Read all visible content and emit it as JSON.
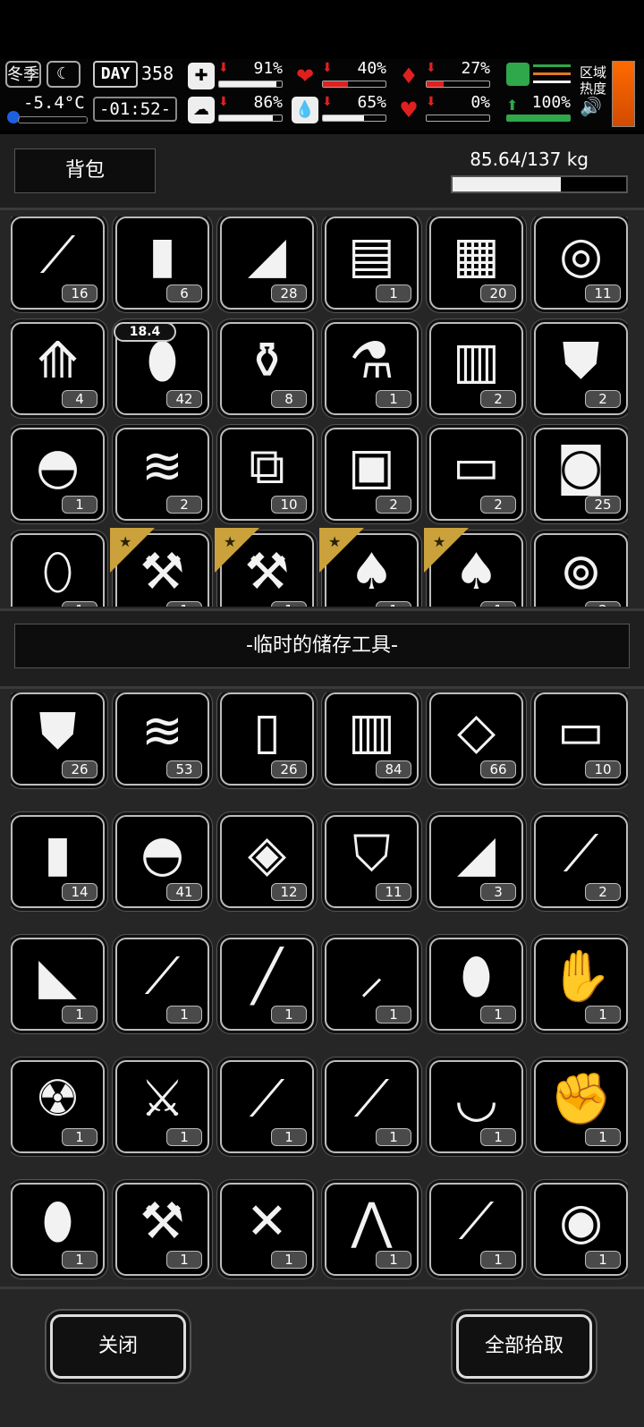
{
  "hud": {
    "season": "冬季",
    "moon": "☾",
    "temperature": "-5.4°C",
    "day_label": "DAY",
    "day": "358",
    "clock": "-01:52-",
    "stats": [
      {
        "name": "health",
        "icon": "✚",
        "pct": "91%",
        "value": 0.91,
        "color": "#f0f0f0",
        "red": false
      },
      {
        "name": "stomach",
        "icon": "❤",
        "pct": "40%",
        "value": 0.4,
        "color": "#e02020",
        "red": true
      },
      {
        "name": "lungs",
        "icon": "♦",
        "pct": "27%",
        "value": 0.27,
        "color": "#e02020",
        "red": true
      },
      {
        "name": "brain",
        "icon": "☁",
        "pct": "86%",
        "value": 0.86,
        "color": "#f0f0f0",
        "red": false
      },
      {
        "name": "water",
        "icon": "💧",
        "pct": "65%",
        "value": 0.65,
        "color": "#f0f0f0",
        "red": false
      },
      {
        "name": "heart",
        "icon": "♥",
        "pct": "0%",
        "value": 0.0,
        "color": "#e02020",
        "red": true
      }
    ],
    "stamina_pct": "100%",
    "region_label": "区域热度",
    "speaker": "🔊"
  },
  "backpack": {
    "tab": "背包",
    "weight": "85.64/137 kg",
    "weight_fill": 0.625,
    "items": [
      {
        "icon": "⟋",
        "count": "16"
      },
      {
        "icon": "▮",
        "count": "6"
      },
      {
        "icon": "◢",
        "count": "28"
      },
      {
        "icon": "▤",
        "count": "1"
      },
      {
        "icon": "▦",
        "count": "20"
      },
      {
        "icon": "◎",
        "count": "11"
      },
      {
        "icon": "⟰",
        "count": "4"
      },
      {
        "icon": "⬮",
        "count": "42",
        "durability": "18.4"
      },
      {
        "icon": "⚱",
        "count": "8"
      },
      {
        "icon": "⚗",
        "count": "1"
      },
      {
        "icon": "▥",
        "count": "2"
      },
      {
        "icon": "⛊",
        "count": "2"
      },
      {
        "icon": "◓",
        "count": "1"
      },
      {
        "icon": "≋",
        "count": "2"
      },
      {
        "icon": "⧉",
        "count": "10"
      },
      {
        "icon": "▣",
        "count": "2"
      },
      {
        "icon": "▭",
        "count": "2"
      },
      {
        "icon": "◙",
        "count": "25"
      },
      {
        "icon": "⬯",
        "count": "1"
      },
      {
        "icon": "⚒",
        "count": "1",
        "star": true
      },
      {
        "icon": "⚒",
        "count": "1",
        "star": true
      },
      {
        "icon": "♠",
        "count": "1",
        "star": true
      },
      {
        "icon": "♠",
        "count": "1",
        "star": true
      },
      {
        "icon": "⊚",
        "count": "2"
      }
    ]
  },
  "storage": {
    "title": "-临时的储存工具-",
    "items": [
      {
        "icon": "⛊",
        "count": "26"
      },
      {
        "icon": "≋",
        "count": "53"
      },
      {
        "icon": "▯",
        "count": "26"
      },
      {
        "icon": "▥",
        "count": "84"
      },
      {
        "icon": "◇",
        "count": "66"
      },
      {
        "icon": "▭",
        "count": "10"
      },
      {
        "icon": "▮",
        "count": "14"
      },
      {
        "icon": "◓",
        "count": "41"
      },
      {
        "icon": "◈",
        "count": "12"
      },
      {
        "icon": "⛉",
        "count": "11"
      },
      {
        "icon": "◢",
        "count": "3"
      },
      {
        "icon": "⟋",
        "count": "2"
      },
      {
        "icon": "◣",
        "count": "1"
      },
      {
        "icon": "⟋",
        "count": "1"
      },
      {
        "icon": "╱",
        "count": "1"
      },
      {
        "icon": "⸝",
        "count": "1"
      },
      {
        "icon": "⬮",
        "count": "1"
      },
      {
        "icon": "✋",
        "count": "1"
      },
      {
        "icon": "☢",
        "count": "1"
      },
      {
        "icon": "⚔",
        "count": "1"
      },
      {
        "icon": "⟋",
        "count": "1"
      },
      {
        "icon": "⟋",
        "count": "1"
      },
      {
        "icon": "◡",
        "count": "1"
      },
      {
        "icon": "✊",
        "count": "1"
      },
      {
        "icon": "⬮",
        "count": "1"
      },
      {
        "icon": "⚒",
        "count": "1"
      },
      {
        "icon": "✕",
        "count": "1"
      },
      {
        "icon": "⋀",
        "count": "1"
      },
      {
        "icon": "⟋",
        "count": "1"
      },
      {
        "icon": "◉",
        "count": "1"
      },
      {
        "icon": "♨",
        "count": ""
      },
      {
        "icon": "⟋",
        "count": ""
      }
    ]
  },
  "footer": {
    "close": "关闭",
    "take_all": "全部拾取"
  }
}
